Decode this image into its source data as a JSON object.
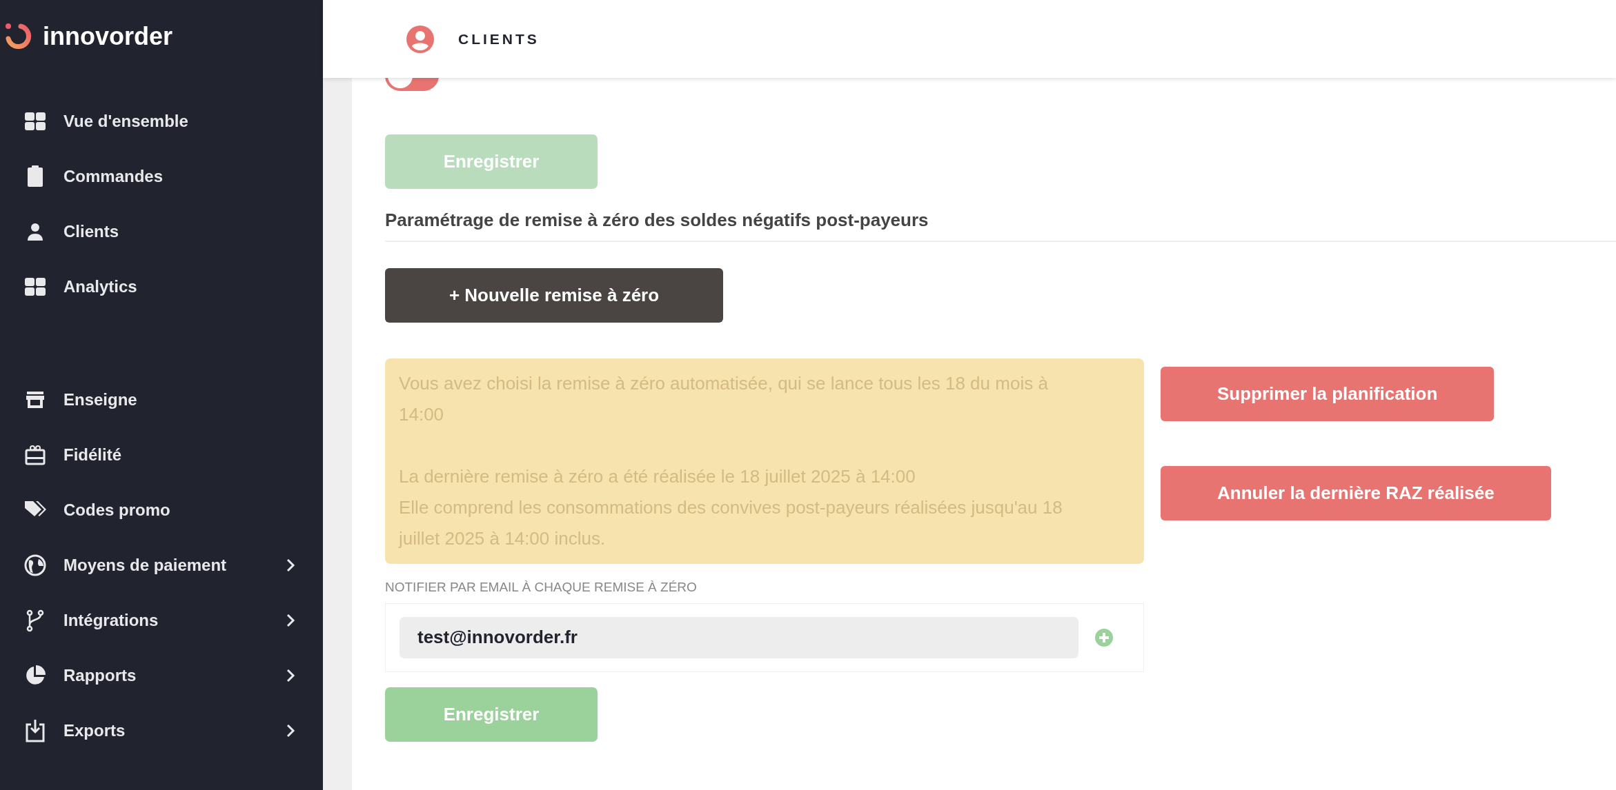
{
  "sidebar": {
    "logo": "innovorder",
    "groups": [
      [
        {
          "label": "Vue d'ensemble",
          "has_submenu": false
        },
        {
          "label": "Commandes",
          "has_submenu": false
        },
        {
          "label": "Clients",
          "has_submenu": false
        },
        {
          "label": "Analytics",
          "has_submenu": false
        }
      ],
      [
        {
          "label": "Enseigne",
          "has_submenu": false
        },
        {
          "label": "Fidélité",
          "has_submenu": false
        },
        {
          "label": "Codes promo",
          "has_submenu": false
        },
        {
          "label": "Moyens de paiement",
          "has_submenu": true
        },
        {
          "label": "Intégrations",
          "has_submenu": true
        },
        {
          "label": "Rapports",
          "has_submenu": true
        },
        {
          "label": "Exports",
          "has_submenu": true
        }
      ]
    ]
  },
  "header": {
    "title": "CLIENTS"
  },
  "toggle": {
    "on": true
  },
  "save_button_top": {
    "label": "Enregistrer",
    "disabled": true
  },
  "section": {
    "title": "Paramétrage de remise à zéro des soldes négatifs post-payeurs",
    "new_button": "+ Nouvelle remise à zéro",
    "notice": {
      "paragraphs": [
        [
          "Vous avez choisi la remise à zéro automatisée, qui se lance tous les 18 du mois à 14:00"
        ],
        [
          "La dernière remise à zéro a été réalisée le 18 juillet 2025 à 14:00",
          "Elle comprend les consommations des convives post-payeurs réalisées jusqu'au 18 juillet 2025 à 14:00 inclus."
        ]
      ]
    },
    "actions": [
      "Supprimer la planification",
      "Annuler la dernière RAZ réalisée"
    ],
    "email_label": "NOTIFIER PAR EMAIL À CHAQUE REMISE À ZÉRO",
    "emails": [
      "test@innovorder.fr"
    ]
  },
  "save_button_bottom": {
    "label": "Enregistrer",
    "disabled": false
  }
}
